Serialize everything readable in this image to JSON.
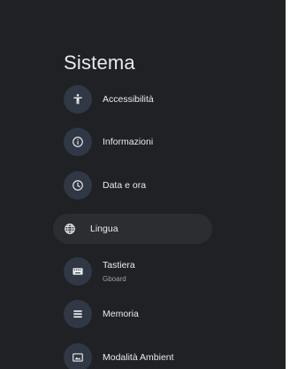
{
  "title": "Sistema",
  "items": [
    {
      "label": "Accessibilità",
      "icon": "accessibility-icon"
    },
    {
      "label": "Informazioni",
      "icon": "info-icon"
    },
    {
      "label": "Data e ora",
      "icon": "clock-icon"
    },
    {
      "label": "Lingua",
      "icon": "globe-icon"
    },
    {
      "label": "Tastiera",
      "subtitle": "Gboard",
      "icon": "keyboard-icon"
    },
    {
      "label": "Memoria",
      "icon": "storage-icon"
    },
    {
      "label": "Modalità Ambient",
      "icon": "ambient-icon"
    }
  ]
}
